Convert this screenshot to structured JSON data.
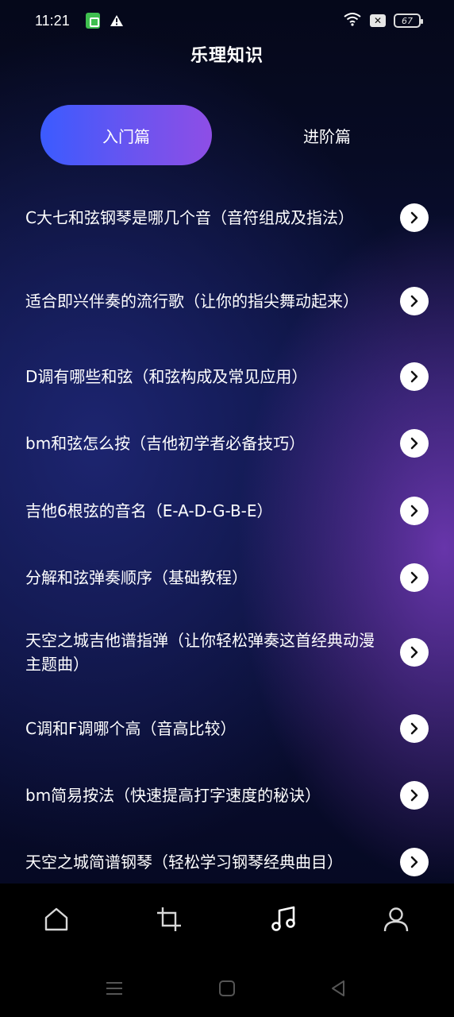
{
  "status_bar": {
    "time": "11:21",
    "battery": "67",
    "icons": [
      "sim-icon",
      "warning-icon",
      "wifi-icon",
      "x-box-icon",
      "battery-icon"
    ]
  },
  "page": {
    "title": "乐理知识"
  },
  "tabs": [
    {
      "label": "入门篇",
      "active": true
    },
    {
      "label": "进阶篇",
      "active": false
    }
  ],
  "items": [
    {
      "title": "C大七和弦钢琴是哪几个音（音符组成及指法）"
    },
    {
      "title": "适合即兴伴奏的流行歌（让你的指尖舞动起来）"
    },
    {
      "title": "D调有哪些和弦（和弦构成及常见应用）"
    },
    {
      "title": "bm和弦怎么按（吉他初学者必备技巧）"
    },
    {
      "title": "吉他6根弦的音名（E-A-D-G-B-E）"
    },
    {
      "title": "分解和弦弹奏顺序（基础教程）"
    },
    {
      "title": "天空之城吉他谱指弹（让你轻松弹奏这首经典动漫主题曲）"
    },
    {
      "title": "C调和F调哪个高（音高比较）"
    },
    {
      "title": "bm简易按法（快速提高打字速度的秘诀）"
    },
    {
      "title": "天空之城简谱钢琴（轻松学习钢琴经典曲目）"
    }
  ],
  "bottom_nav": {
    "items": [
      {
        "icon": "home-icon",
        "active": false
      },
      {
        "icon": "crop-icon",
        "active": false
      },
      {
        "icon": "music-note-icon",
        "active": true
      },
      {
        "icon": "user-icon",
        "active": false
      }
    ]
  },
  "system_nav": [
    "menu-icon",
    "home-square-icon",
    "back-triangle-icon"
  ],
  "colors": {
    "tab_gradient_start": "#3b5bff",
    "tab_gradient_end": "#8e4ee6",
    "background_dark": "#070b24",
    "text": "#ffffff"
  }
}
